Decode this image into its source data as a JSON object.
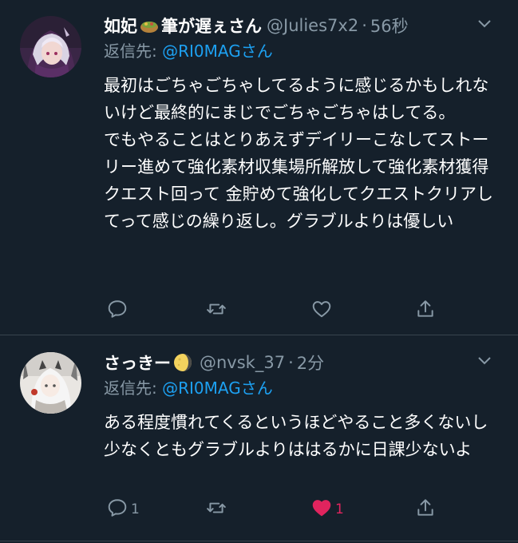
{
  "tweets": [
    {
      "display_name": "如妃",
      "display_name_suffix": "筆が遅ぇさん",
      "emoji_icon": "food-bowl-icon",
      "handle": "@Julies7x2",
      "time": "56秒",
      "reply_prefix": "返信先: ",
      "reply_to": "@RI0MAGさん",
      "text": "最初はごちゃごちゃしてるように感じるかもしれないけど最終的にまじでごちゃごちゃはしてる。\nでもやることはとりあえずデイリーこなしてストーリー進めて強化素材収集場所解放して強化素材獲得クエスト回って 金貯めて強化してクエストクリアしてって感じの繰り返し。グラブルよりは優しい",
      "actions": {
        "reply_count": "",
        "retweet_count": "",
        "like_count": "",
        "liked": false
      }
    },
    {
      "display_name": "さっきー",
      "emoji_icon": "moon-icon",
      "handle": "@nvsk_37",
      "time": "2分",
      "reply_prefix": "返信先: ",
      "reply_to": "@RI0MAGさん",
      "text": "ある程度慣れてくるというほどやること多くないし少なくともグラブルよりははるかに日課少ないよ",
      "actions": {
        "reply_count": "1",
        "retweet_count": "",
        "like_count": "1",
        "liked": true
      }
    }
  ],
  "colors": {
    "background": "#15202b",
    "text": "#ffffff",
    "secondary": "#8899a6",
    "accent": "#1da1f2",
    "like": "#e0245e",
    "divider": "#38444d"
  }
}
